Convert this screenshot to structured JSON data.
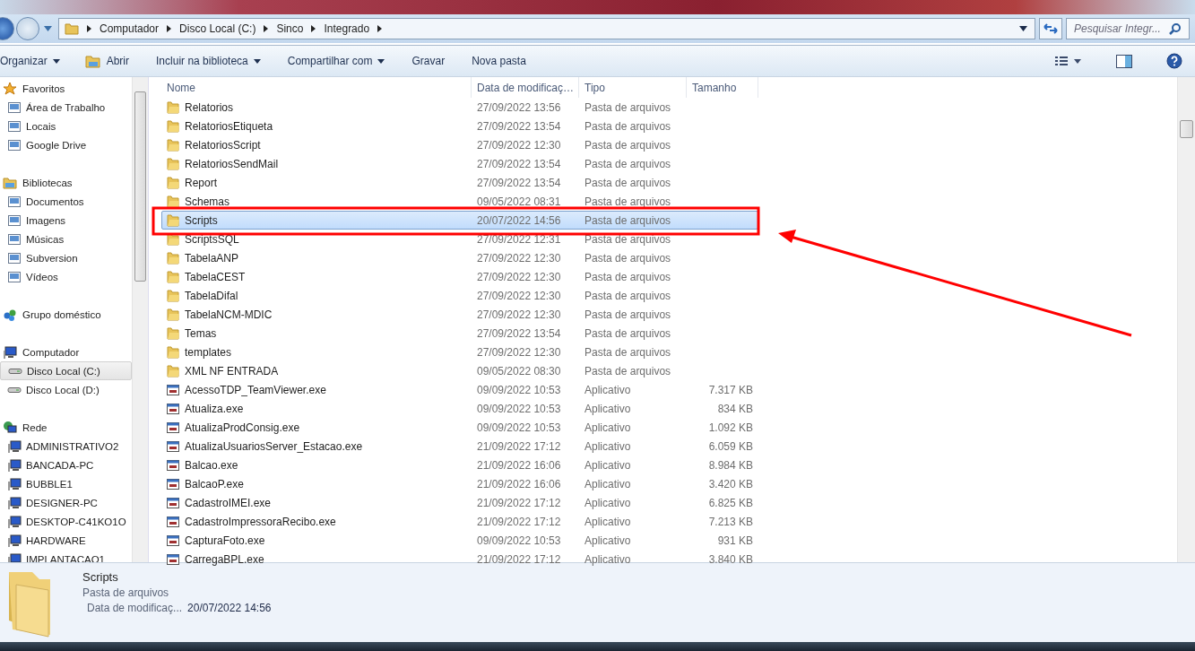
{
  "address_bar": {
    "path": [
      "Computador",
      "Disco Local (C:)",
      "Sinco",
      "Integrado"
    ]
  },
  "search": {
    "placeholder": "Pesquisar Integr..."
  },
  "toolbar": {
    "items": [
      {
        "label": "Organizar",
        "dropdown": true,
        "kind": "menu"
      },
      {
        "label": "Abrir",
        "dropdown": false,
        "kind": "open"
      },
      {
        "label": "Incluir na biblioteca",
        "dropdown": true,
        "kind": "menu"
      },
      {
        "label": "Compartilhar com",
        "dropdown": true,
        "kind": "menu"
      },
      {
        "label": "Gravar",
        "dropdown": false,
        "kind": "menu"
      },
      {
        "label": "Nova pasta",
        "dropdown": false,
        "kind": "menu"
      }
    ]
  },
  "sidebar": {
    "groups": [
      {
        "label": "Favoritos",
        "kind": "favorites",
        "children": [
          {
            "label": "Área de Trabalho",
            "selected": false
          },
          {
            "label": "Locais",
            "selected": false
          },
          {
            "label": "Google Drive",
            "selected": false
          }
        ]
      },
      {
        "label": "Bibliotecas",
        "kind": "libraries",
        "children": [
          {
            "label": "Documentos",
            "selected": false
          },
          {
            "label": "Imagens",
            "selected": false
          },
          {
            "label": "Músicas",
            "selected": false
          },
          {
            "label": "Subversion",
            "selected": false
          },
          {
            "label": "Vídeos",
            "selected": false
          }
        ]
      },
      {
        "label": "Grupo doméstico",
        "kind": "homegroup"
      },
      {
        "label": "Computador",
        "kind": "computer",
        "children": [
          {
            "label": "Disco Local (C:)",
            "selected": true
          },
          {
            "label": "Disco Local (D:)",
            "selected": false
          }
        ]
      },
      {
        "label": "Rede",
        "kind": "network",
        "children": [
          {
            "label": "ADMINISTRATIVO2",
            "selected": false
          },
          {
            "label": "BANCADA-PC",
            "selected": false
          },
          {
            "label": "BUBBLE1",
            "selected": false
          },
          {
            "label": "DESIGNER-PC",
            "selected": false
          },
          {
            "label": "DESKTOP-C41KO1O",
            "selected": false
          },
          {
            "label": "HARDWARE",
            "selected": false
          },
          {
            "label": "IMPLANTACAO1",
            "selected": false
          }
        ]
      }
    ]
  },
  "table": {
    "columns": [
      "Nome",
      "Data de modificaç…",
      "Tipo",
      "Tamanho"
    ],
    "rows": [
      {
        "name": "Relatorios",
        "date": "27/09/2022 13:56",
        "type": "Pasta de arquivos",
        "kind": "folder",
        "selected": false
      },
      {
        "name": "RelatoriosEtiqueta",
        "date": "27/09/2022 13:54",
        "type": "Pasta de arquivos",
        "kind": "folder",
        "selected": false
      },
      {
        "name": "RelatoriosScript",
        "date": "27/09/2022 12:30",
        "type": "Pasta de arquivos",
        "kind": "folder",
        "selected": false
      },
      {
        "name": "RelatoriosSendMail",
        "date": "27/09/2022 13:54",
        "type": "Pasta de arquivos",
        "kind": "folder",
        "selected": false
      },
      {
        "name": "Report",
        "date": "27/09/2022 13:54",
        "type": "Pasta de arquivos",
        "kind": "folder",
        "selected": false
      },
      {
        "name": "Schemas",
        "date": "09/05/2022 08:31",
        "type": "Pasta de arquivos",
        "kind": "folder",
        "selected": false
      },
      {
        "name": "Scripts",
        "date": "20/07/2022 14:56",
        "type": "Pasta de arquivos",
        "kind": "folder",
        "selected": true
      },
      {
        "name": "ScriptsSQL",
        "date": "27/09/2022 12:31",
        "type": "Pasta de arquivos",
        "kind": "folder",
        "selected": false
      },
      {
        "name": "TabelaANP",
        "date": "27/09/2022 12:30",
        "type": "Pasta de arquivos",
        "kind": "folder",
        "selected": false
      },
      {
        "name": "TabelaCEST",
        "date": "27/09/2022 12:30",
        "type": "Pasta de arquivos",
        "kind": "folder",
        "selected": false
      },
      {
        "name": "TabelaDifal",
        "date": "27/09/2022 12:30",
        "type": "Pasta de arquivos",
        "kind": "folder",
        "selected": false
      },
      {
        "name": "TabelaNCM-MDIC",
        "date": "27/09/2022 12:30",
        "type": "Pasta de arquivos",
        "kind": "folder",
        "selected": false
      },
      {
        "name": "Temas",
        "date": "27/09/2022 13:54",
        "type": "Pasta de arquivos",
        "kind": "folder",
        "selected": false
      },
      {
        "name": "templates",
        "date": "27/09/2022 12:30",
        "type": "Pasta de arquivos",
        "kind": "folder",
        "selected": false
      },
      {
        "name": "XML NF ENTRADA",
        "date": "09/05/2022 08:30",
        "type": "Pasta de arquivos",
        "kind": "folder",
        "selected": false
      },
      {
        "name": "AcessoTDP_TeamViewer.exe",
        "date": "09/09/2022 10:53",
        "type": "Aplicativo",
        "size": "7.317 KB",
        "kind": "app",
        "selected": false
      },
      {
        "name": "Atualiza.exe",
        "date": "09/09/2022 10:53",
        "type": "Aplicativo",
        "size": "834 KB",
        "kind": "app",
        "selected": false
      },
      {
        "name": "AtualizaProdConsig.exe",
        "date": "09/09/2022 10:53",
        "type": "Aplicativo",
        "size": "1.092 KB",
        "kind": "app",
        "selected": false
      },
      {
        "name": "AtualizaUsuariosServer_Estacao.exe",
        "date": "21/09/2022 17:12",
        "type": "Aplicativo",
        "size": "6.059 KB",
        "kind": "app",
        "selected": false
      },
      {
        "name": "Balcao.exe",
        "date": "21/09/2022 16:06",
        "type": "Aplicativo",
        "size": "8.984 KB",
        "kind": "app",
        "selected": false
      },
      {
        "name": "BalcaoP.exe",
        "date": "21/09/2022 16:06",
        "type": "Aplicativo",
        "size": "3.420 KB",
        "kind": "app",
        "selected": false
      },
      {
        "name": "CadastroIMEI.exe",
        "date": "21/09/2022 17:12",
        "type": "Aplicativo",
        "size": "6.825 KB",
        "kind": "app",
        "selected": false
      },
      {
        "name": "CadastroImpressoraRecibo.exe",
        "date": "21/09/2022 17:12",
        "type": "Aplicativo",
        "size": "7.213 KB",
        "kind": "app",
        "selected": false
      },
      {
        "name": "CapturaFoto.exe",
        "date": "09/09/2022 10:53",
        "type": "Aplicativo",
        "size": "931 KB",
        "kind": "app",
        "selected": false
      },
      {
        "name": "CarregaBPL.exe",
        "date": "21/09/2022 17:12",
        "type": "Aplicativo",
        "size": "3.840 KB",
        "kind": "app",
        "selected": false
      }
    ]
  },
  "details_pane": {
    "name": "Scripts",
    "type": "Pasta de arquivos",
    "label": "Data de modificaç...",
    "value": "20/07/2022 14:56"
  }
}
